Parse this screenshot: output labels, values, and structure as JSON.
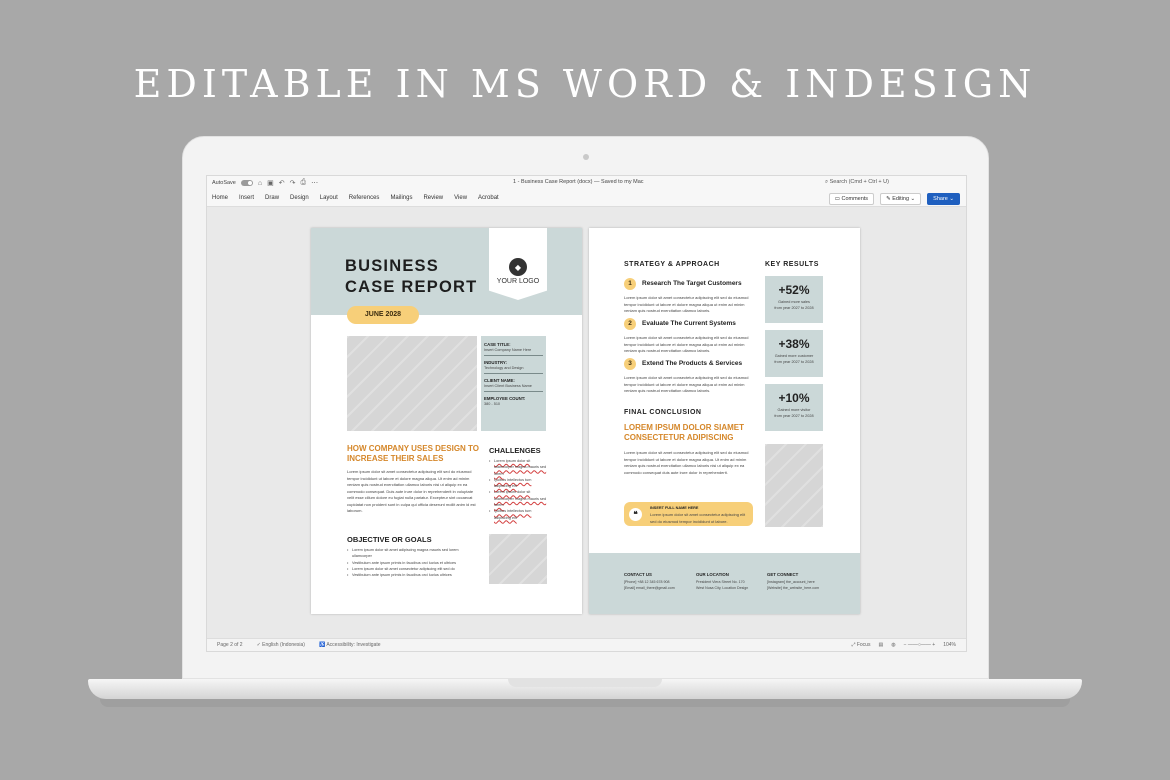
{
  "headline": "EDITABLE IN MS WORD & INDESIGN",
  "word": {
    "autosave_label": "AutoSave",
    "doc_title": "1 - Business Case Report (docx) — Saved to my Mac",
    "search_placeholder": "Search (Cmd + Ctrl + U)",
    "ribbon_tabs": [
      "Home",
      "Insert",
      "Draw",
      "Design",
      "Layout",
      "References",
      "Mailings",
      "Review",
      "View",
      "Acrobat"
    ],
    "comments_label": "Comments",
    "editing_label": "Editing",
    "share_label": "Share",
    "status": {
      "page": "Page 2 of 2",
      "language": "English (Indonesia)",
      "accessibility": "Accessibility: Investigate",
      "focus": "Focus",
      "zoom": "104%"
    }
  },
  "page1": {
    "title_line1": "BUSINESS",
    "title_line2": "CASE REPORT",
    "logo": "YOUR LOGO",
    "date": "JUNE 2028",
    "info": [
      {
        "label": "CASE TITLE:",
        "value": "Insert Company Name Here"
      },
      {
        "label": "INDUSTRY:",
        "value": "Technology and Design"
      },
      {
        "label": "CLIENT NAME:",
        "value": "Insert Client Business Name"
      },
      {
        "label": "EMPLOYEE COUNT:",
        "value": "380 - 510"
      }
    ],
    "how_heading": "HOW COMPANY USES DESIGN TO INCREASE THEIR SALES",
    "how_text": "Lorem ipsum dolor sit amet consectetur adipiscing elit sed do eiusmod tempor incididunt ut labore et dolore magna aliqua. Ut enim ad minim veniam quis nostrud exercitation ullamco laboris nisi ut aliquip ex ea commodo consequat. Duis aute irure dolor in reprehenderit in voluptate velit esse cillum dolore eu fugiat nulla pariatur. Excepteur sint occaecat cupidatat non proident sunt in culpa qui officia deserunt mollit anim id est laborum.",
    "challenges_heading": "CHALLENGES",
    "challenges": [
      "Lorem ipsum dolor sit ullamcorper magna mauris sed lorem",
      "Quibus intellectus tum adipiscing elit",
      "Lorem ipsum dolor sit ullamcorper magna mauris sed lorem",
      "Quibus intellectus tum adipiscing elit"
    ],
    "objective_heading": "OBJECTIVE OR GOALS",
    "goals": [
      "Lorem ipsum dolor sit amet adipiscing magna mauris sed lorem ullamcorper",
      "Vestibulum ante ipsum primis in faucibus orci luctus et ultrices",
      "Lorem ipsum dolor sit amet consectetur adipiscing elit sed do",
      "Vestibulum ante ipsum primis in faucibus orci luctus ultrices"
    ]
  },
  "page2": {
    "strategy_heading": "STRATEGY & APPROACH",
    "steps": [
      {
        "num": "1",
        "title": "Research The Target Customers",
        "text": "Lorem ipsum dolor sit amet consectetur adipiscing elit sed do eiusmod tempor incididunt ut labore et dolore magna aliqua ut enim ad minim veniam quis nostrud exercitation ullamco laboris."
      },
      {
        "num": "2",
        "title": "Evaluate The Current Systems",
        "text": "Lorem ipsum dolor sit amet consectetur adipiscing elit sed do eiusmod tempor incididunt ut labore et dolore magna aliqua ut enim ad minim veniam quis nostrud exercitation ullamco laboris."
      },
      {
        "num": "3",
        "title": "Extend The Products & Services",
        "text": "Lorem ipsum dolor sit amet consectetur adipiscing elit sed do eiusmod tempor incididunt ut labore et dolore magna aliqua ut enim ad minim veniam quis nostrud exercitation ullamco laboris."
      }
    ],
    "key_results_heading": "KEY RESULTS",
    "key_results": [
      {
        "value": "+52%",
        "line1": "Gained more sales",
        "line2": "from year 2027 to 2028"
      },
      {
        "value": "+38%",
        "line1": "Gained more customer",
        "line2": "from year 2027 to 2028"
      },
      {
        "value": "+10%",
        "line1": "Gained more visitor",
        "line2": "from year 2027 to 2028"
      }
    ],
    "conclusion_heading": "FINAL CONCLUSION",
    "conclusion_sub": "LOREM IPSUM DOLOR SIAMET CONSECTETUR ADIPISCING",
    "conclusion_text": "Lorem ipsum dolor sit amet consectetur adipiscing elit sed do eiusmod tempor incididunt ut labore et dolore magna aliqua. Ut enim ad minim veniam quis nostrud exercitation ullamco laboris nisi ut aliquip ex ea commodo consequat duis aute irure dolor in reprehenderit.",
    "quote_name": "INSERT FULL NAME HERE",
    "quote_text": "Lorem ipsum dolor sit amet consectetur adipiscing elit sed do eiusmod tempor incididunt ut labore.",
    "footer": {
      "contact_heading": "CONTACT US",
      "contact_lines": [
        "[Phone] +88 12 345 678 908",
        "[Email] email_there@gmail.com"
      ],
      "location_heading": "OUR LOCATION",
      "location_lines": [
        "President Viera Street No. 170",
        "West Nusa City, Location Design"
      ],
      "connect_heading": "GET CONNECT",
      "connect_lines": [
        "[Instagram] the_account_here",
        "[Website] the_website_here.com"
      ]
    }
  }
}
